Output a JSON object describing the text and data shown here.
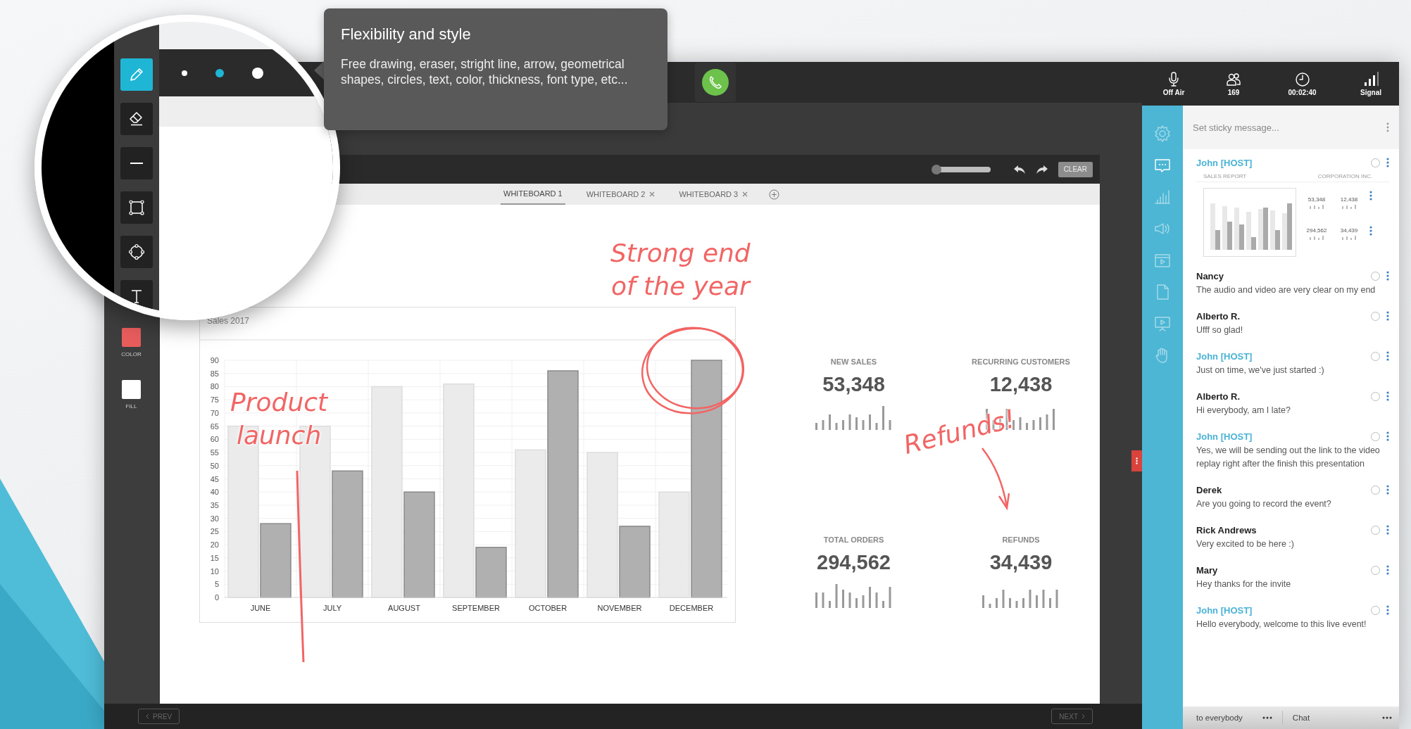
{
  "tooltip": {
    "title": "Flexibility and style",
    "body": "Free drawing, eraser, stright line, arrow, geometrical shapes, circles, text, color, thickness, font type, etc..."
  },
  "tools": [
    {
      "kind": "pencil",
      "selected": true
    },
    {
      "kind": "eraser",
      "selected": false
    },
    {
      "kind": "line",
      "selected": false
    },
    {
      "kind": "rectangle",
      "selected": false
    },
    {
      "kind": "circle",
      "selected": false
    },
    {
      "kind": "text",
      "selected": false
    }
  ],
  "thickness": [
    {
      "kind": "small",
      "selected": false
    },
    {
      "kind": "medium",
      "selected": true
    },
    {
      "kind": "large",
      "selected": false
    }
  ],
  "swatches": [
    {
      "label": "COLOR",
      "color": "#e85c5c"
    },
    {
      "label": "FILL",
      "color": "#ffffff"
    }
  ],
  "zoom_slider": {
    "level": 0
  },
  "clear_button": "CLEAR",
  "whiteboard_tabs": [
    {
      "label": "WHITEBOARD 1",
      "selected": true,
      "closable": false
    },
    {
      "label": "WHITEBOARD 2",
      "selected": false,
      "closable": true
    },
    {
      "label": "WHITEBOARD 3",
      "selected": false,
      "closable": true
    }
  ],
  "chart": {
    "chart_data": {
      "type": "bar",
      "title": "Sales 2017",
      "categories": [
        "JUNE",
        "JULY",
        "AUGUST",
        "SEPTEMBER",
        "OCTOBER",
        "NOVEMBER",
        "DECEMBER"
      ],
      "series": [
        {
          "color": "#ebebeb",
          "values": [
            65,
            65,
            80,
            81,
            56,
            55,
            40
          ]
        },
        {
          "color": "#b0b0b0",
          "values": [
            28,
            48,
            40,
            19,
            86,
            27,
            90
          ]
        }
      ],
      "grid": true,
      "ylim": [
        0,
        90
      ],
      "yticks": [
        0,
        5,
        10,
        15,
        20,
        25,
        30,
        35,
        40,
        45,
        50,
        55,
        60,
        65,
        70,
        75,
        80,
        85,
        90
      ]
    }
  },
  "kpis": [
    {
      "label": "NEW SALES",
      "value": "53,348"
    },
    {
      "label": "RECURRING CUSTOMERS",
      "value": "12,438"
    },
    {
      "label": "TOTAL ORDERS",
      "value": "294,562"
    },
    {
      "label": "REFUNDS",
      "value": "34,439"
    }
  ],
  "notes": [
    {
      "lines": [
        "Strong end",
        "of the year"
      ]
    },
    {
      "lines": [
        "Product",
        "launch"
      ]
    },
    {
      "lines": [
        "Refunds!"
      ]
    }
  ],
  "pager": {
    "prev": "PREV",
    "next": "NEXT"
  },
  "status": [
    {
      "kind": "mic",
      "label": "Off Air"
    },
    {
      "kind": "people",
      "label": "169"
    },
    {
      "kind": "clock",
      "label": "00:02:40"
    },
    {
      "kind": "signal",
      "label": "Signal"
    }
  ],
  "sidebar": [
    {
      "kind": "settings",
      "selected": false
    },
    {
      "kind": "chat",
      "selected": true
    },
    {
      "kind": "stats",
      "selected": false
    },
    {
      "kind": "announce",
      "selected": false
    },
    {
      "kind": "video",
      "selected": false
    },
    {
      "kind": "document",
      "selected": false
    },
    {
      "kind": "presentation",
      "selected": false
    },
    {
      "kind": "hand",
      "selected": false
    }
  ],
  "sticky": {
    "placeholder": "Set sticky message..."
  },
  "messages": [
    {
      "author": "John [HOST]",
      "color": "#4ab3d6",
      "attachment": {
        "title": "SALES REPORT",
        "company": "CORPORATION INC.",
        "figures": [
          "53,348",
          "12,438",
          "294,562",
          "34,439"
        ]
      }
    },
    {
      "author": "Nancy",
      "color": "#222222",
      "text": "The audio and video are very clear on my end"
    },
    {
      "author": "Alberto R.",
      "color": "#222222",
      "text": "Ufff so glad!"
    },
    {
      "author": "John [HOST]",
      "color": "#4ab3d6",
      "text": "Just on time, we've just started :)"
    },
    {
      "author": "Alberto R.",
      "color": "#222222",
      "text": "Hi everybody, am I late?"
    },
    {
      "author": "John [HOST]",
      "color": "#4ab3d6",
      "text": "Yes, we will be sending out the link to the video replay right after the finish this presentation"
    },
    {
      "author": "Derek",
      "color": "#222222",
      "text": "Are you going to record the event?"
    },
    {
      "author": "Rick Andrews",
      "color": "#222222",
      "text": "Very excited to be here :)"
    },
    {
      "author": "Mary",
      "color": "#222222",
      "text": "Hey thanks for the invite"
    },
    {
      "author": "John [HOST]",
      "color": "#4ab3d6",
      "text": "Hello everybody, welcome to this live event!"
    }
  ],
  "composer": {
    "recipient": "to everybody",
    "mode": "Chat"
  }
}
